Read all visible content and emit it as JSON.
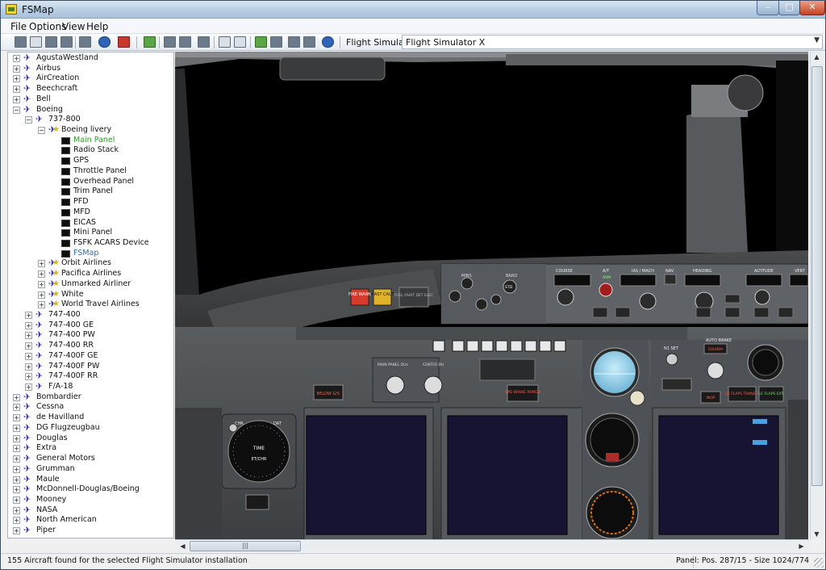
{
  "window": {
    "title": "FSMap",
    "min_glyph": "–",
    "max_glyph": "□",
    "close_glyph": "✕"
  },
  "menu": [
    "File",
    "Options",
    "View",
    "Help"
  ],
  "toolbar": {
    "sim_label": "Flight Simulator",
    "sim_value": "Flight Simulator X"
  },
  "tree": [
    {
      "label": "AgustaWestland",
      "level": 0,
      "type": "maker",
      "expander": "+"
    },
    {
      "label": "Airbus",
      "level": 0,
      "type": "maker",
      "expander": "+"
    },
    {
      "label": "AirCreation",
      "level": 0,
      "type": "maker",
      "expander": "+"
    },
    {
      "label": "Beechcraft",
      "level": 0,
      "type": "maker",
      "expander": "+"
    },
    {
      "label": "Bell",
      "level": 0,
      "type": "maker",
      "expander": "+"
    },
    {
      "label": "Boeing",
      "level": 0,
      "type": "maker",
      "expander": "−"
    },
    {
      "label": "737-800",
      "level": 1,
      "type": "model",
      "expander": "−"
    },
    {
      "label": "Boeing livery",
      "level": 2,
      "type": "livery",
      "expander": "−"
    },
    {
      "label": "Main Panel",
      "level": 3,
      "type": "panel",
      "state": "selected"
    },
    {
      "label": "Radio Stack",
      "level": 3,
      "type": "panel"
    },
    {
      "label": "GPS",
      "level": 3,
      "type": "panel"
    },
    {
      "label": "Throttle Panel",
      "level": 3,
      "type": "panel"
    },
    {
      "label": "Overhead Panel",
      "level": 3,
      "type": "panel"
    },
    {
      "label": "Trim Panel",
      "level": 3,
      "type": "panel"
    },
    {
      "label": "PFD",
      "level": 3,
      "type": "panel"
    },
    {
      "label": "MFD",
      "level": 3,
      "type": "panel"
    },
    {
      "label": "EICAS",
      "level": 3,
      "type": "panel"
    },
    {
      "label": "Mini Panel",
      "level": 3,
      "type": "panel"
    },
    {
      "label": "FSFK ACARS Device",
      "level": 3,
      "type": "panel"
    },
    {
      "label": "FSMap",
      "level": 3,
      "type": "panel",
      "state": "highlight"
    },
    {
      "label": "Orbit Airlines",
      "level": 2,
      "type": "livery",
      "expander": "+"
    },
    {
      "label": "Pacifica Airlines",
      "level": 2,
      "type": "livery",
      "expander": "+"
    },
    {
      "label": "Unmarked Airliner",
      "level": 2,
      "type": "livery",
      "expander": "+"
    },
    {
      "label": "White",
      "level": 2,
      "type": "livery",
      "expander": "+"
    },
    {
      "label": "World Travel Airlines",
      "level": 2,
      "type": "livery",
      "expander": "+"
    },
    {
      "label": "747-400",
      "level": 1,
      "type": "model",
      "expander": "+"
    },
    {
      "label": "747-400 GE",
      "level": 1,
      "type": "model",
      "expander": "+"
    },
    {
      "label": "747-400 PW",
      "level": 1,
      "type": "model",
      "expander": "+"
    },
    {
      "label": "747-400 RR",
      "level": 1,
      "type": "model",
      "expander": "+"
    },
    {
      "label": "747-400F GE",
      "level": 1,
      "type": "model",
      "expander": "+"
    },
    {
      "label": "747-400F PW",
      "level": 1,
      "type": "model",
      "expander": "+"
    },
    {
      "label": "747-400F RR",
      "level": 1,
      "type": "model",
      "expander": "+"
    },
    {
      "label": "F/A-18",
      "level": 1,
      "type": "model",
      "expander": "+"
    },
    {
      "label": "Bombardier",
      "level": 0,
      "type": "maker",
      "expander": "+"
    },
    {
      "label": "Cessna",
      "level": 0,
      "type": "maker",
      "expander": "+"
    },
    {
      "label": "de Havilland",
      "level": 0,
      "type": "maker",
      "expander": "+"
    },
    {
      "label": "DG Flugzeugbau",
      "level": 0,
      "type": "maker",
      "expander": "+"
    },
    {
      "label": "Douglas",
      "level": 0,
      "type": "maker",
      "expander": "+"
    },
    {
      "label": "Extra",
      "level": 0,
      "type": "maker",
      "expander": "+"
    },
    {
      "label": "General Motors",
      "level": 0,
      "type": "maker",
      "expander": "+"
    },
    {
      "label": "Grumman",
      "level": 0,
      "type": "maker",
      "expander": "+"
    },
    {
      "label": "Maule",
      "level": 0,
      "type": "maker",
      "expander": "+"
    },
    {
      "label": "McDonnell-Douglas/Boeing",
      "level": 0,
      "type": "maker",
      "expander": "+"
    },
    {
      "label": "Mooney",
      "level": 0,
      "type": "maker",
      "expander": "+"
    },
    {
      "label": "NASA",
      "level": 0,
      "type": "maker",
      "expander": "+"
    },
    {
      "label": "North American",
      "level": 0,
      "type": "maker",
      "expander": "+"
    },
    {
      "label": "Piper",
      "level": 0,
      "type": "maker",
      "expander": "+"
    }
  ],
  "cockpit": {
    "fire_warn": "FIRE WARN",
    "mast_caut": "MAST CAUT",
    "fuel_label": "FUEL OVHT DET ELEC",
    "course": "COURSE",
    "at": "A/T",
    "arm": "ARM",
    "ias_mach": "IAS / MACH",
    "nav": "NAV",
    "heading": "HEADING",
    "altitude": "ALTITUDE",
    "vert": "VERT",
    "auto_brake": "AUTO BRAKE",
    "disarm": "DISARM",
    "below_gs": "BELOW G/S",
    "spd_brake": "SPD BRAKE ARMED",
    "inop": "INOP",
    "le_flaps_transit": "LE FLAPS TRANSIT",
    "le_flaps_ext": "LE FLAPS EXT",
    "main_panel_dus": "MAIN PANEL DUs",
    "center_du": "CENTER DU",
    "time": "TIME",
    "et_chr": "ET/CHR",
    "chr": "CHR",
    "dat": "DAT",
    "n1_set": "N1 SET",
    "mins": "MINS",
    "baro": "BARO",
    "std": "STD"
  },
  "status": {
    "left": "155 Aircraft found for the selected Flight Simulator installation",
    "right": "Panel: Pos. 287/15 - Size 1024/774"
  },
  "colors": {
    "selected": "#2a9d24",
    "highlight": "#2a6bbd",
    "plane": "#3c2fb0"
  }
}
